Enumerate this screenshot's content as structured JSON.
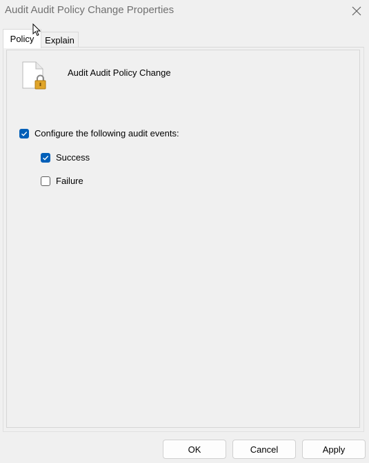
{
  "window": {
    "title": "Audit Audit Policy Change Properties"
  },
  "tabs": [
    {
      "label": "Policy",
      "selected": true
    },
    {
      "label": "Explain",
      "selected": false
    }
  ],
  "policy": {
    "name": "Audit Audit Policy Change",
    "icon": "document-lock-icon"
  },
  "options": {
    "configure": {
      "label": "Configure the following audit events:",
      "checked": true
    },
    "success": {
      "label": "Success",
      "checked": true
    },
    "failure": {
      "label": "Failure",
      "checked": false
    }
  },
  "buttons": {
    "ok": "OK",
    "cancel": "Cancel",
    "apply": "Apply"
  },
  "colors": {
    "accent": "#005fb8",
    "background": "#f0f0f0",
    "title_text": "#707070"
  }
}
